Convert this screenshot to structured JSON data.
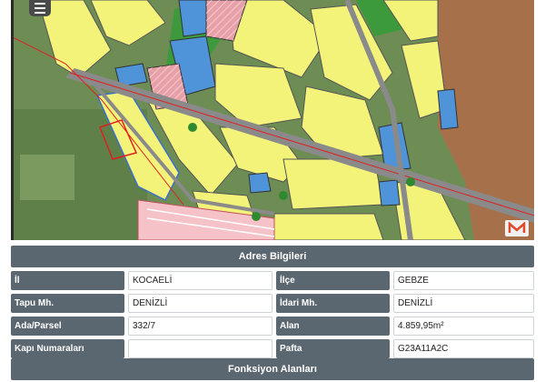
{
  "map": {
    "menu_icon": "hamburger-menu-icon",
    "logo_icon": "m-logo-icon",
    "colors": {
      "residential": "#f3f37a",
      "public": "#4f93d8",
      "industrial": "#f5c2c8",
      "historic": "#a5704a",
      "green": "#3c9a3c",
      "boundary": "#e02020",
      "road": "#888888"
    }
  },
  "address": {
    "title": "Adres Bilgileri",
    "rows": [
      {
        "label1": "İl",
        "value1": "KOCAELİ",
        "label2": "İlçe",
        "value2": "GEBZE"
      },
      {
        "label1": "Tapu Mh.",
        "value1": "DENİZLİ",
        "label2": "İdari Mh.",
        "value2": "DENİZLİ"
      },
      {
        "label1": "Ada/Parsel",
        "value1": "332/7",
        "label2": "Alan",
        "value2": "4.859,95m²"
      },
      {
        "label1": "Kapı Numaraları",
        "value1": "",
        "label2": "Pafta",
        "value2": "G23A11A2C"
      }
    ]
  },
  "functions": {
    "title": "Fonksiyon Alanları"
  }
}
